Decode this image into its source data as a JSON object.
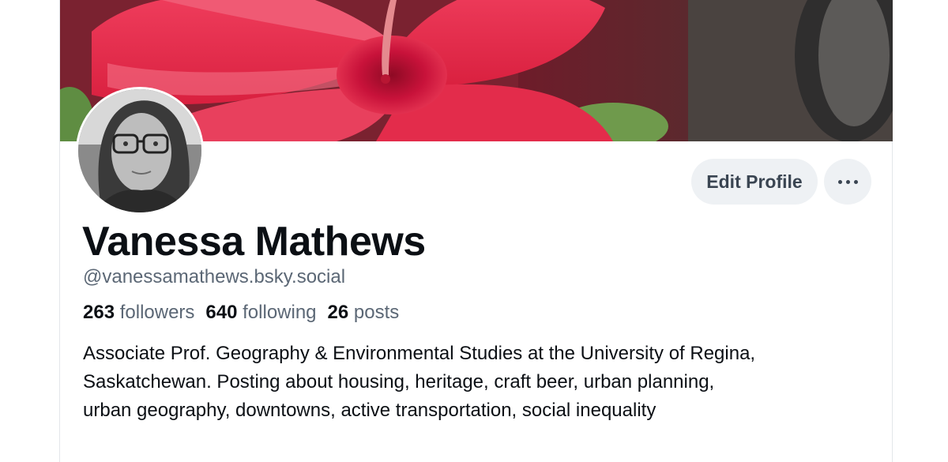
{
  "profile": {
    "display_name": "Vanessa Mathews",
    "handle": "@vanessamathews.bsky.social",
    "stats": {
      "followers_count": "263",
      "followers_label": "followers",
      "following_count": "640",
      "following_label": "following",
      "posts_count": "26",
      "posts_label": "posts"
    },
    "bio_lines": [
      "Associate Prof. Geography & Environmental Studies at the University of Regina,",
      "Saskatchewan. Posting about housing, heritage, craft beer, urban planning,",
      "urban geography, downtowns, active transportation, social inequality"
    ]
  },
  "actions": {
    "edit_profile_label": "Edit Profile",
    "more_icon": "ellipsis-icon"
  },
  "images": {
    "banner": "red-hibiscus-flower-photo",
    "avatar": "grayscale-portrait-woman-glasses"
  },
  "colors": {
    "name_text": "#0b0f14",
    "secondary_text": "#5b6775",
    "button_bg": "#eef1f4",
    "button_text": "#3a4552"
  }
}
